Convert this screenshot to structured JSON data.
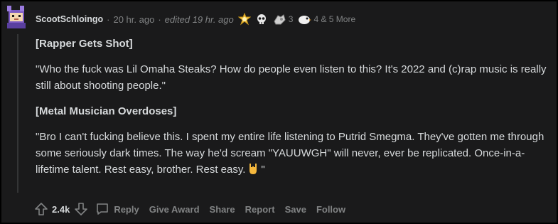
{
  "comment": {
    "username": "ScootSchloingo",
    "time_ago": "20 hr. ago",
    "separator": "·",
    "edited": "edited 19 hr. ago",
    "awards": [
      {
        "icon": "gold-award-icon"
      },
      {
        "icon": "skull-award-icon"
      },
      {
        "icon": "hands-award-icon",
        "count": "3"
      },
      {
        "icon": "bird-award-icon",
        "count": "4 & 5 More"
      }
    ],
    "paragraphs": [
      {
        "text": "[Rapper Gets Shot]",
        "bold": true
      },
      {
        "text": "\"Who the fuck was Lil Omaha Steaks? How do people even listen to this? It's 2022 and (c)rap music is really still about shooting people.\"",
        "bold": false
      },
      {
        "text": "[Metal Musician Overdoses]",
        "bold": true
      },
      {
        "text": "\"Bro I can't fucking believe this. I spent my entire life listening to Putrid Smegma. They've gotten me through some seriously dark times. The way he'd scream \"YAUUWGH\" will never, ever be replicated. Once-in-a-lifetime talent. Rest easy, brother. Rest easy.",
        "bold": false,
        "suffix": "\""
      }
    ],
    "score": "2.4k",
    "actions": {
      "reply": "Reply",
      "give_award": "Give Award",
      "share": "Share",
      "report": "Report",
      "save": "Save",
      "follow": "Follow"
    }
  },
  "colors": {
    "background": "#1a1a1b",
    "text": "#d7dadc",
    "meta": "#818384",
    "thread_line": "#343536"
  }
}
